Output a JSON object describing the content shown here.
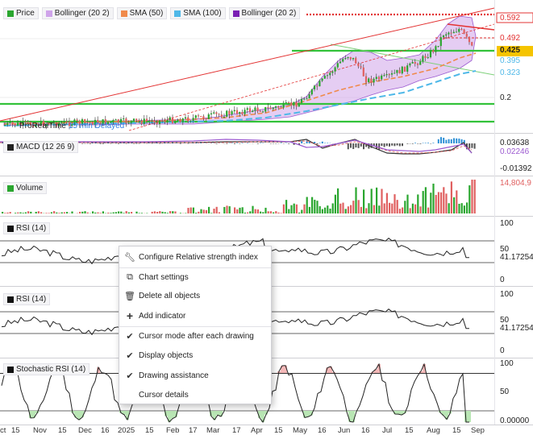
{
  "legend": {
    "price": "Price",
    "boll1": "Bollinger (20 2)",
    "sma50": "SMA (50)",
    "sma100": "SMA (100)",
    "boll2": "Bollinger (20 2)"
  },
  "price_axis": {
    "lbl_592": "0.592",
    "lbl_492": "0.492",
    "lbl_425": "0.425",
    "lbl_395": "0.395",
    "lbl_323": "0.323",
    "lbl_2": "0.2"
  },
  "realtime": {
    "source": "ProRealTime",
    "delay": "15 min Delayed"
  },
  "macd": {
    "label": "MACD (12 26 9)",
    "v1": "0.03638",
    "v2": "0.02246",
    "v3": "-0.01392"
  },
  "volume": {
    "label": "Volume",
    "value": "14,804,9"
  },
  "rsi1": {
    "label": "RSI (14)",
    "top": "100",
    "mid": "50",
    "val": "41.17254",
    "bot": "0"
  },
  "rsi2": {
    "label": "RSI (14)",
    "top": "100",
    "mid": "50",
    "val": "41.17254",
    "bot": "0"
  },
  "stoch": {
    "label": "Stochastic RSI (14)",
    "top": "100",
    "mid": "50",
    "val": "0.00000"
  },
  "dates": {
    "d0": "ct",
    "d1": "15",
    "d2": "Nov",
    "d3": "15",
    "d4": "Dec",
    "d5": "16",
    "d6": "2025",
    "d7": "15",
    "d8": "Feb",
    "d9": "17",
    "d10": "Mar",
    "d11": "17",
    "d12": "Apr",
    "d13": "15",
    "d14": "May",
    "d15": "16",
    "d16": "Jun",
    "d17": "16",
    "d18": "Jul",
    "d19": "15",
    "d20": "Aug",
    "d21": "15",
    "d22": "Sep"
  },
  "menu": {
    "configure": "Configure Relative strength index",
    "chart_settings": "Chart settings",
    "delete_all": "Delete all objects",
    "add_indicator": "Add indicator",
    "cursor_mode": "Cursor mode after each drawing",
    "display_objects": "Display objects",
    "drawing_assistance": "Drawing assistance",
    "cursor_details": "Cursor details"
  },
  "colors": {
    "bollinger": "#9b59d0",
    "sma50": "#f08a4b",
    "sma100": "#4fb8e8",
    "support": "#33c23a",
    "resistance": "#e33333",
    "up": "#2aa62f",
    "down": "#e06060"
  },
  "chart_data": [
    {
      "type": "line",
      "title": "Price",
      "series": [
        {
          "name": "Price",
          "values": [
            0.1,
            0.1,
            0.11,
            0.11,
            0.11,
            0.12,
            0.12,
            0.12,
            0.13,
            0.13,
            0.13,
            0.14,
            0.14,
            0.15,
            0.15,
            0.16,
            0.18,
            0.22,
            0.26,
            0.31,
            0.36,
            0.4,
            0.43,
            0.41,
            0.38,
            0.36,
            0.34,
            0.35,
            0.36,
            0.37,
            0.38,
            0.4,
            0.46,
            0.5,
            0.56,
            0.59,
            0.58,
            0.53,
            0.43
          ]
        },
        {
          "name": "SMA (50)",
          "values": [
            0.1,
            0.1,
            0.1,
            0.11,
            0.11,
            0.11,
            0.11,
            0.12,
            0.12,
            0.12,
            0.12,
            0.13,
            0.13,
            0.13,
            0.14,
            0.14,
            0.15,
            0.16,
            0.18,
            0.2,
            0.22,
            0.25,
            0.27,
            0.29,
            0.3,
            0.31,
            0.32,
            0.33,
            0.33,
            0.34,
            0.35,
            0.36,
            0.37,
            0.38,
            0.4,
            0.42,
            0.43,
            0.43,
            0.4
          ]
        },
        {
          "name": "SMA (100)",
          "values": [
            0.1,
            0.1,
            0.1,
            0.1,
            0.1,
            0.11,
            0.11,
            0.11,
            0.11,
            0.11,
            0.12,
            0.12,
            0.12,
            0.12,
            0.13,
            0.13,
            0.13,
            0.14,
            0.14,
            0.15,
            0.16,
            0.17,
            0.18,
            0.2,
            0.21,
            0.22,
            0.23,
            0.24,
            0.25,
            0.26,
            0.27,
            0.28,
            0.29,
            0.3,
            0.31,
            0.32,
            0.33,
            0.33,
            0.32
          ]
        }
      ],
      "levels": [
        0.592,
        0.492,
        0.425,
        0.395,
        0.323,
        0.2
      ]
    }
  ]
}
